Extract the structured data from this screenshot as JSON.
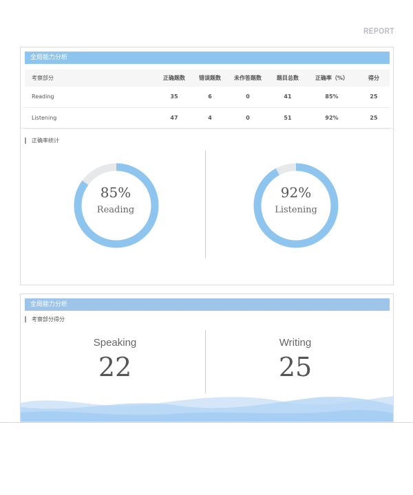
{
  "header": {
    "report_label": "REPORT"
  },
  "overall": {
    "title": "全局能力分析",
    "columns": [
      "考察部分",
      "正确题数",
      "错误题数",
      "未作答题数",
      "题目总数",
      "正确率（%）",
      "得分"
    ],
    "rows": [
      {
        "section": "Reading",
        "correct": "35",
        "wrong": "6",
        "unanswered": "0",
        "total": "41",
        "accuracy": "85%",
        "score": "25"
      },
      {
        "section": "Listening",
        "correct": "47",
        "wrong": "4",
        "unanswered": "0",
        "total": "51",
        "accuracy": "92%",
        "score": "25"
      }
    ],
    "accuracy_section_label": "正确率统计",
    "donuts": [
      {
        "percent_text": "85%",
        "label": "Reading",
        "fraction": 0.85
      },
      {
        "percent_text": "92%",
        "label": "Listening",
        "fraction": 0.92
      }
    ]
  },
  "section_scores": {
    "title": "全局能力分析",
    "section_label": "考察部分得分",
    "items": [
      {
        "name": "Speaking",
        "score": "22"
      },
      {
        "name": "Writing",
        "score": "25"
      }
    ]
  },
  "colors": {
    "accent": "#8ec5ef",
    "track": "#e6e8ea",
    "score_blue": "#5ab0e8",
    "wave": "#b3d6f5"
  }
}
